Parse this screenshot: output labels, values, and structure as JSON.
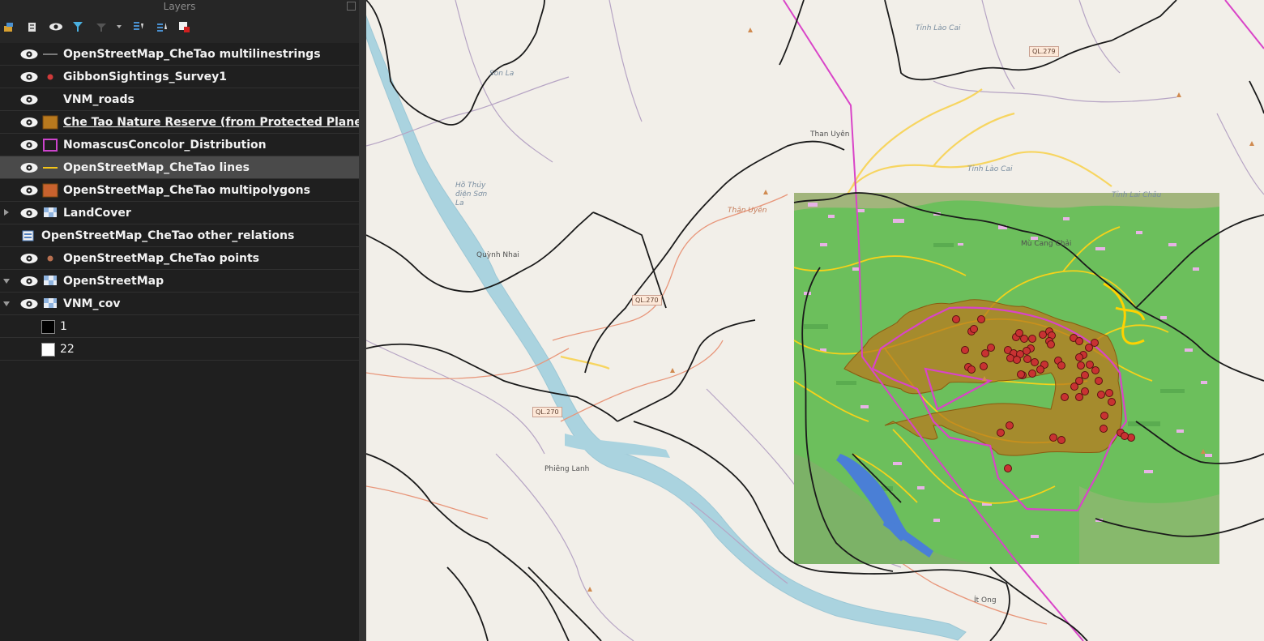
{
  "panel": {
    "title": "Layers"
  },
  "toolbar": {
    "icons": [
      "open-layer-styling-icon",
      "add-group-icon",
      "manage-visibility-icon",
      "filter-legend-icon",
      "filter-by-expression-icon",
      "expand-all-icon",
      "collapse-all-icon",
      "remove-layer-icon"
    ]
  },
  "layers": [
    {
      "name": "OpenStreetMap_CheTao multilinestrings",
      "symbol": "line",
      "color": "#7a7a7a",
      "visible": true
    },
    {
      "name": "GibbonSightings_Survey1",
      "symbol": "point",
      "color": "#d03a3a",
      "visible": true
    },
    {
      "name": "VNM_roads",
      "symbol": "none",
      "visible": true
    },
    {
      "name": "Che Tao Nature Reserve (from Protected Planet)",
      "symbol": "fill",
      "color": "#b8791e",
      "visible": true,
      "underlined": true
    },
    {
      "name": "NomascusConcolor_Distribution",
      "symbol": "outline",
      "color": "#cc44cc",
      "visible": true
    },
    {
      "name": "OpenStreetMap_CheTao lines",
      "symbol": "line",
      "color": "#f5c518",
      "visible": true,
      "selected": true
    },
    {
      "name": "OpenStreetMap_CheTao multipolygons",
      "symbol": "fill",
      "color": "#c8622e",
      "visible": true
    },
    {
      "name": "LandCover",
      "symbol": "raster",
      "visible": true,
      "expander": "collapsed"
    },
    {
      "name": "OpenStreetMap_CheTao other_relations",
      "symbol": "table",
      "visible": false
    },
    {
      "name": "OpenStreetMap_CheTao points",
      "symbol": "point",
      "color": "#b87050",
      "visible": true
    },
    {
      "name": "OpenStreetMap",
      "symbol": "raster",
      "visible": true,
      "expander": "expanded"
    },
    {
      "name": "VNM_cov",
      "symbol": "raster",
      "visible": true,
      "expander": "expanded"
    }
  ],
  "legend_items": [
    {
      "label": "1",
      "color": "#000000"
    },
    {
      "label": "22",
      "color": "#ffffff"
    }
  ],
  "map": {
    "place_labels": [
      "Son La",
      "Than Uyên",
      "Tỉnh Lào Cai",
      "Tỉnh Lai Châu",
      "Hồ Thủy điện Sơn La",
      "Quỳnh Nhai",
      "Thân Uyên",
      "Mù Cang Chải",
      "Phiêng Lanh",
      "Tỉnh Lào Cai",
      "Ít Ong"
    ],
    "road_shields": [
      "QL.270",
      "QL.270",
      "QL.279"
    ],
    "colors": {
      "background": "#f2efe9",
      "water": "#aad3df",
      "landcover": "#6cbf5c",
      "reserve": "#b8791e",
      "distribution": "#cc44cc",
      "sightings": "#c83232",
      "admin": "#1a1a1a"
    },
    "sightings_count": 62
  }
}
